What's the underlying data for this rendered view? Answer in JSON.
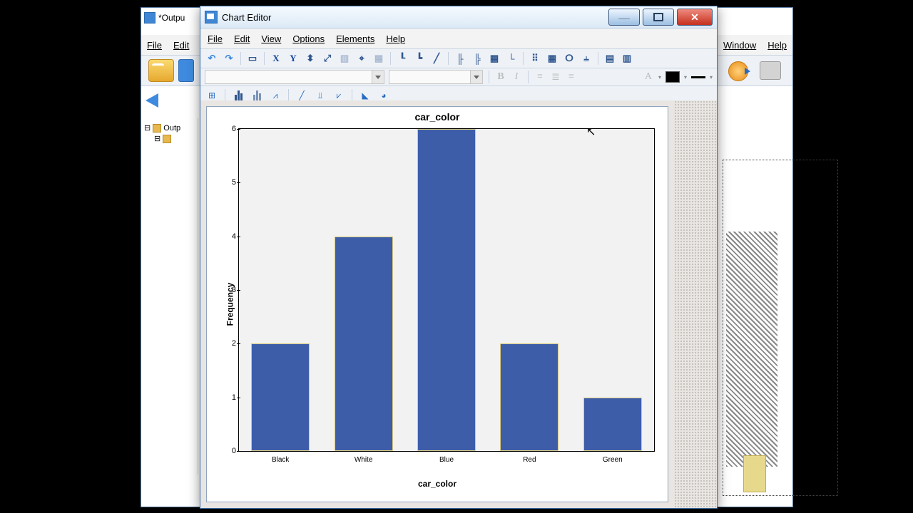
{
  "bg_window": {
    "title_fragment": "*Outpu",
    "menu": {
      "file": "File",
      "edit": "Edit",
      "window": "Window",
      "help": "Help"
    },
    "tree": {
      "root": "Outp"
    }
  },
  "chart_editor": {
    "title": "Chart Editor",
    "menu": {
      "file": "File",
      "edit": "Edit",
      "view": "View",
      "options": "Options",
      "elements": "Elements",
      "help": "Help"
    },
    "fmt": {
      "bold": "B",
      "italic": "I",
      "font_btn": "A"
    }
  },
  "chart_data": {
    "type": "bar",
    "title": "car_color",
    "xlabel": "car_color",
    "ylabel": "Frequency",
    "ylim": [
      0,
      6
    ],
    "yticks": [
      0,
      1,
      2,
      3,
      4,
      5,
      6
    ],
    "categories": [
      "Black",
      "White",
      "Blue",
      "Red",
      "Green"
    ],
    "values": [
      2,
      4,
      6,
      2,
      1
    ],
    "bar_color": "#3e5da8"
  }
}
